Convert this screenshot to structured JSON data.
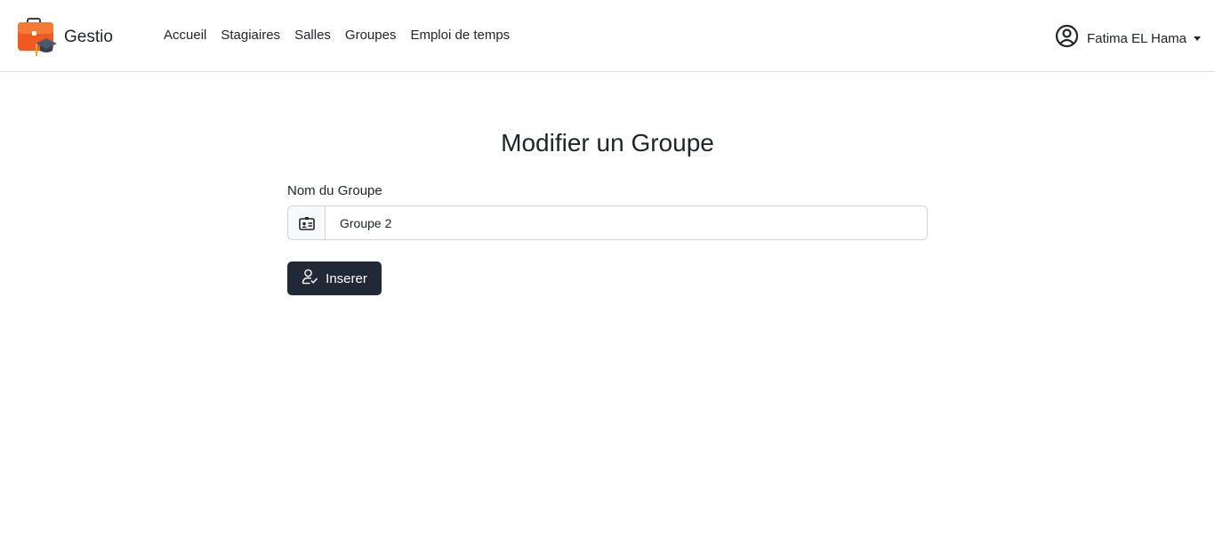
{
  "brand": {
    "name": "Gestio",
    "logo_icon": "briefcase-graduation-icon",
    "logo_color": "#f05a22"
  },
  "nav": {
    "items": [
      {
        "label": "Accueil"
      },
      {
        "label": "Stagiaires"
      },
      {
        "label": "Salles"
      },
      {
        "label": "Groupes"
      },
      {
        "label": "Emploi de temps"
      }
    ]
  },
  "user": {
    "name": "Fatima EL Hama",
    "icon": "user-circle-icon"
  },
  "page": {
    "title": "Modifier un Groupe"
  },
  "form": {
    "group_name_label": "Nom du Groupe",
    "group_name_value": "Groupe 2",
    "group_name_icon": "id-card-icon",
    "submit_label": "Inserer",
    "submit_icon": "user-check-icon",
    "submit_color": "#212936"
  }
}
